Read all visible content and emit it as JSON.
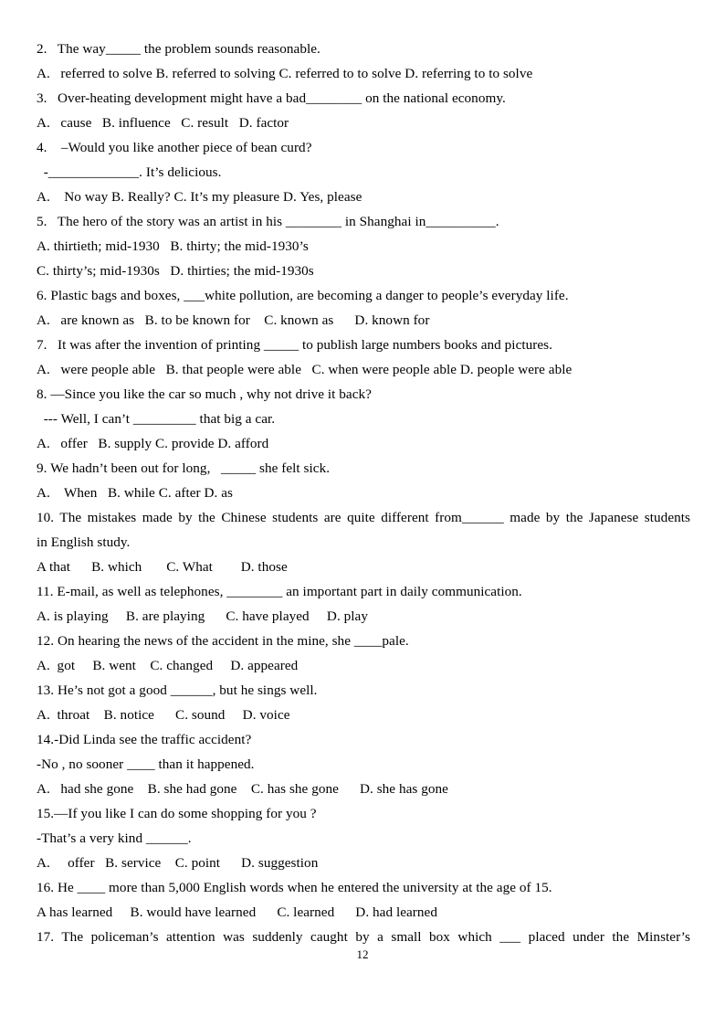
{
  "document": {
    "page_number": "12",
    "lines": [
      {
        "id": "q2-stem",
        "text": "2.   The way_____ the problem sounds reasonable."
      },
      {
        "id": "q2-options",
        "text": "A.   referred to solve B. referred to solving C. referred to to solve D. referring to to solve"
      },
      {
        "id": "q3-stem",
        "text": "3.   Over-heating development might have a bad________ on the national economy."
      },
      {
        "id": "q3-options",
        "text": "A.   cause   B. influence   C. result   D. factor"
      },
      {
        "id": "q4-stem",
        "text": "4.    –Would you like another piece of bean curd?"
      },
      {
        "id": "q4-stem-2",
        "text": "  -_____________. It’s delicious."
      },
      {
        "id": "q4-options",
        "text": "A.    No way B. Really? C. It’s my pleasure D. Yes, please"
      },
      {
        "id": "q5-stem",
        "text": "5.   The hero of the story was an artist in his ________ in Shanghai in__________."
      },
      {
        "id": "q5-options-a",
        "text": "A. thirtieth; mid-1930   B. thirty; the mid-1930’s"
      },
      {
        "id": "q5-options-b",
        "text": "C. thirty’s; mid-1930s   D. thirties; the mid-1930s"
      },
      {
        "id": "q6-stem",
        "text": "6. Plastic bags and boxes, ___white pollution, are becoming a danger to people’s everyday life."
      },
      {
        "id": "q6-options",
        "text": "A.   are known as   B. to be known for    C. known as      D. known for"
      },
      {
        "id": "q7-stem",
        "text": "7.   It was after the invention of printing _____ to publish large numbers books and pictures."
      },
      {
        "id": "q7-options",
        "text": "A.   were people able   B. that people were able   C. when were people able D. people were able"
      },
      {
        "id": "q8-stem",
        "text": "8. —Since you like the car so much , why not drive it back?"
      },
      {
        "id": "q8-stem-2",
        "text": "  --- Well, I can’t _________ that big a car."
      },
      {
        "id": "q8-options",
        "text": "A.   offer   B. supply C. provide D. afford"
      },
      {
        "id": "q9-stem",
        "text": "9. We hadn’t been out for long,   _____ she felt sick."
      },
      {
        "id": "q9-options",
        "text": "A.    When   B. while C. after D. as"
      },
      {
        "id": "q10-stem",
        "text": "10. The mistakes made by the Chinese students are quite different from______ made by the Japanese students"
      },
      {
        "id": "q10-stem-2",
        "text": "in English study."
      },
      {
        "id": "q10-options",
        "text": "A that      B. which       C. What        D. those"
      },
      {
        "id": "q11-stem",
        "text": "11. E-mail, as well as telephones, ________ an important part in daily communication."
      },
      {
        "id": "q11-options",
        "text": "A. is playing     B. are playing      C. have played     D. play"
      },
      {
        "id": "q12-stem",
        "text": "12. On hearing the news of the accident in the mine, she ____pale."
      },
      {
        "id": "q12-options",
        "text": "A.  got     B. went    C. changed     D. appeared"
      },
      {
        "id": "q13-stem",
        "text": "13. He’s not got a good ______, but he sings well."
      },
      {
        "id": "q13-options",
        "text": "A.  throat    B. notice      C. sound     D. voice"
      },
      {
        "id": "q14-stem",
        "text": "14.-Did Linda see the traffic accident?"
      },
      {
        "id": "q14-stem-2",
        "text": "-No , no sooner ____ than it happened."
      },
      {
        "id": "q14-options",
        "text": "A.   had she gone    B. she had gone    C. has she gone      D. she has gone"
      },
      {
        "id": "q15-stem",
        "text": "15.—If you like I can do some shopping for you ?"
      },
      {
        "id": "q15-stem-2",
        "text": "-That’s a very kind ______."
      },
      {
        "id": "q15-options",
        "text": "A.     offer   B. service    C. point      D. suggestion"
      },
      {
        "id": "q16-stem",
        "text": "16. He ____ more than 5,000 English words when he entered the university at the age of 15."
      },
      {
        "id": "q16-options",
        "text": "A has learned     B. would have learned      C. learned      D. had learned"
      },
      {
        "id": "q17-stem",
        "text": "17. The policeman’s attention was suddenly caught by a small box which ___ placed under the    Minster’s"
      }
    ]
  }
}
